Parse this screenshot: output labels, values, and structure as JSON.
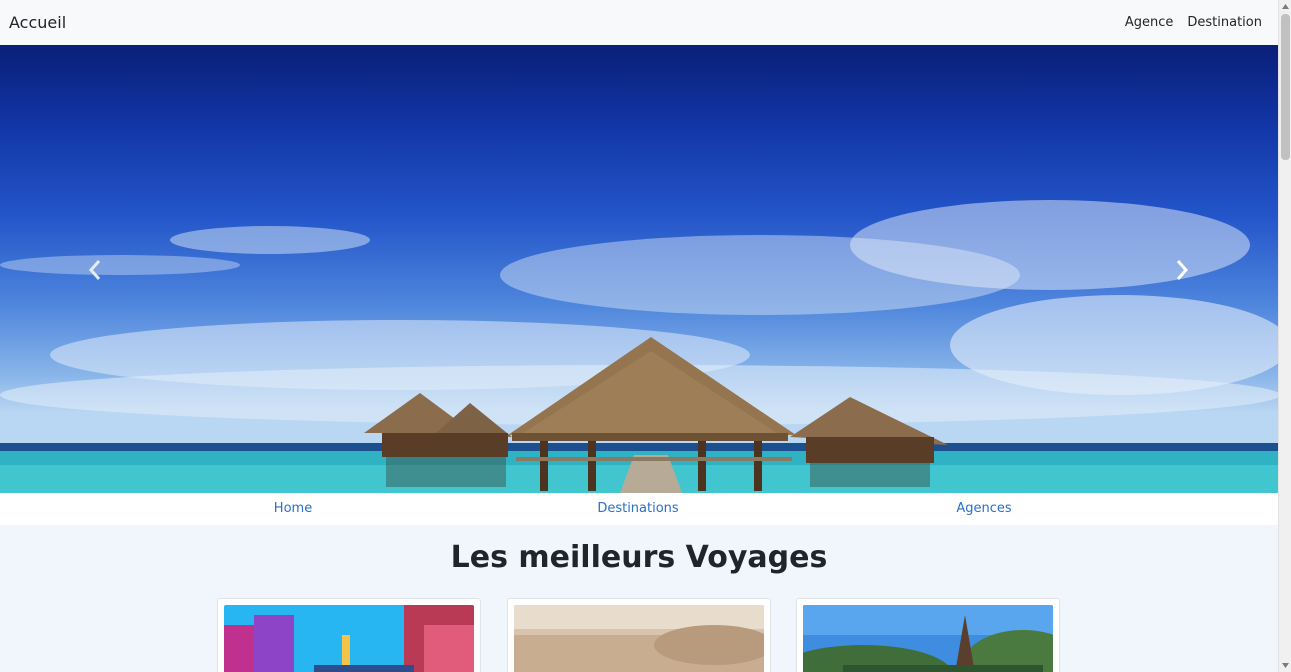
{
  "navbar": {
    "brand": "Accueil",
    "links": [
      {
        "label": "Agence"
      },
      {
        "label": "Destination"
      }
    ]
  },
  "carousel": {
    "prev_icon": "chevron-left-icon",
    "next_icon": "chevron-right-icon"
  },
  "subnav": {
    "links": [
      {
        "label": "Home"
      },
      {
        "label": "Destinations"
      },
      {
        "label": "Agences"
      }
    ]
  },
  "section": {
    "title": "Les meilleurs Voyages"
  },
  "colors": {
    "link": "#2a6fc9",
    "navbar_bg": "#f8f9fa",
    "page_bg": "#f1f6fd"
  }
}
